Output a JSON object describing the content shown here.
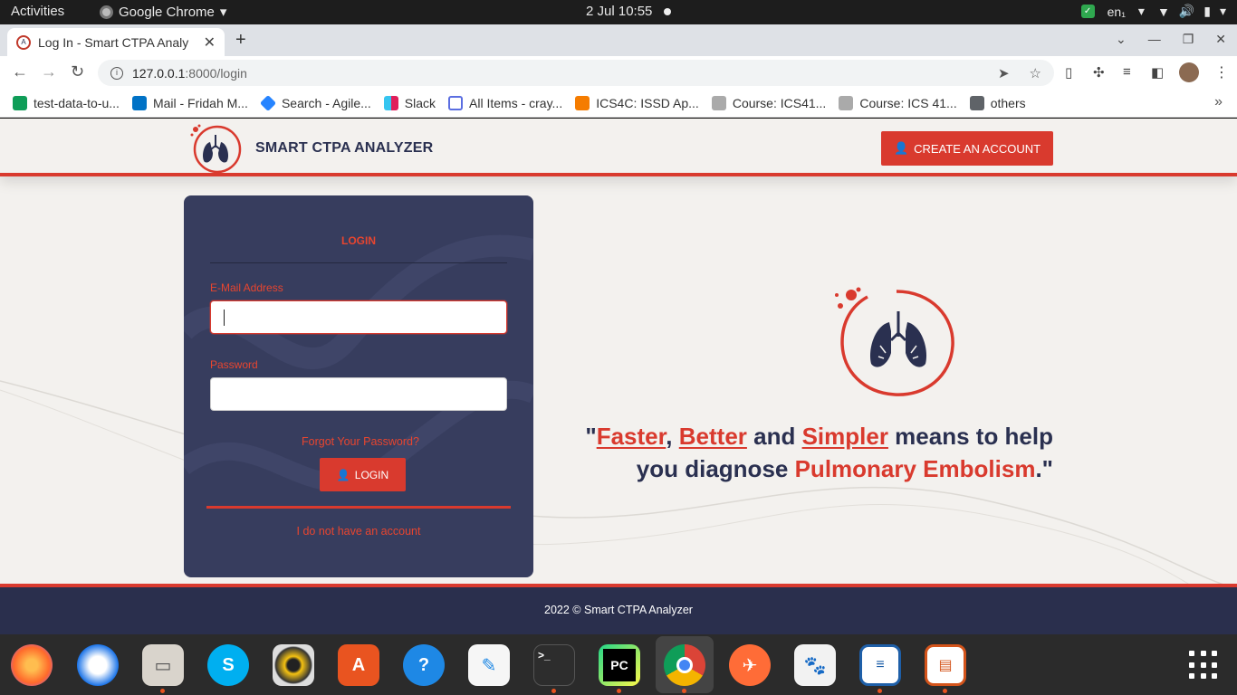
{
  "topbar": {
    "activities": "Activities",
    "app_name": "Google Chrome",
    "clock": "2 Jul  10:55",
    "language": "en₁"
  },
  "browser": {
    "tab_title": "Log In - Smart CTPA Analy",
    "url_host": "127.0.0.1",
    "url_path": ":8000/login",
    "bookmarks": [
      {
        "label": "test-data-to-u...",
        "color": "#0f9d58"
      },
      {
        "label": "Mail - Fridah M...",
        "color": "#0072c6"
      },
      {
        "label": "Search - Agile...",
        "color": "#2684ff"
      },
      {
        "label": "Slack",
        "color": "#e01e5a"
      },
      {
        "label": "All Items - cray...",
        "color": "#5b6ee1"
      },
      {
        "label": "ICS4C: ISSD Ap...",
        "color": "#f57c00"
      },
      {
        "label": "Course: ICS41...",
        "color": "#888888"
      },
      {
        "label": "Course: ICS 41...",
        "color": "#888888"
      },
      {
        "label": "others",
        "color": "#555555"
      }
    ]
  },
  "site": {
    "brand": "SMART CTPA ANALYZER",
    "create_account": "CREATE AN ACCOUNT",
    "login": {
      "title": "LOGIN",
      "email_label": "E-Mail Address",
      "email_value": "",
      "password_label": "Password",
      "password_value": "",
      "forgot": "Forgot Your Password?",
      "button": "LOGIN",
      "no_account": "I do not have an account"
    },
    "hero": {
      "open_quote": "\"",
      "faster": "Faster",
      "comma": ",",
      "better": "Better",
      "and": " and ",
      "simpler": "Simpler",
      "rest1": " means to help",
      "rest2": "you diagnose ",
      "disease": "Pulmonary Embolism",
      "close_quote": ".\""
    },
    "footer": "2022 © Smart CTPA Analyzer",
    "colors": {
      "accent": "#d93a2e",
      "navy": "#2a3050",
      "card": "#373d5e",
      "footer": "#2a2f4d"
    }
  },
  "dock": {
    "apps": [
      "firefox-icon",
      "thunderbird-icon",
      "files-icon",
      "skype-icon",
      "rhythmbox-icon",
      "software-icon",
      "help-icon",
      "text-editor-icon",
      "terminal-icon",
      "pycharm-icon",
      "chrome-icon",
      "postman-icon",
      "gimp-icon",
      "writer-icon",
      "impress-icon"
    ]
  }
}
